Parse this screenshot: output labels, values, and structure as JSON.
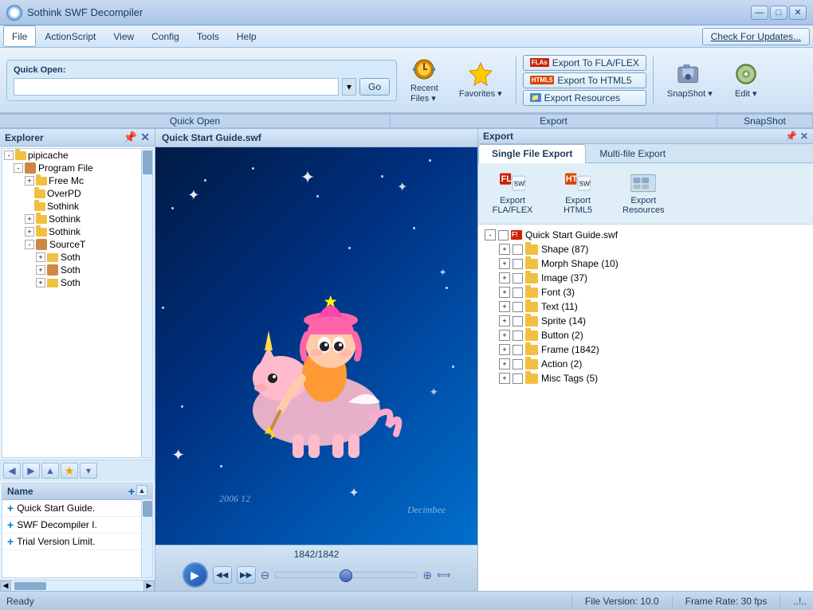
{
  "app": {
    "title": "Sothink SWF Decompiler",
    "check_updates": "Check For Updates..."
  },
  "titlebar": {
    "minimize": "—",
    "maximize": "□",
    "close": "✕"
  },
  "menu": {
    "items": [
      "File",
      "ActionScript",
      "View",
      "Config",
      "Tools",
      "Help"
    ]
  },
  "toolbar": {
    "quick_open_label": "Quick Open:",
    "go_btn": "Go",
    "recent_label": "Recent\nFiles ▾",
    "favorites_label": "Favorites\n▾",
    "export_fla": "Export To FLA/FLEX",
    "export_html5": "Export To HTML5",
    "export_res": "Export Resources",
    "export_group": "Export",
    "snapshot_label": "SnapShot\n▾",
    "edit_label": "Edit\n▾",
    "snapshot_group": "SnapShot",
    "quick_open_section": "Quick Open"
  },
  "explorer": {
    "title": "Explorer",
    "tree_items": [
      {
        "label": "pipicache",
        "level": 0,
        "type": "folder",
        "expanded": true,
        "has_children": true
      },
      {
        "label": "Program File",
        "level": 1,
        "type": "folder",
        "expanded": true,
        "has_children": true
      },
      {
        "label": "Free Mc",
        "level": 2,
        "type": "folder",
        "expanded": false,
        "has_children": true
      },
      {
        "label": "OverPD",
        "level": 2,
        "type": "folder",
        "expanded": false,
        "has_children": false
      },
      {
        "label": "Sothink",
        "level": 2,
        "type": "folder",
        "expanded": false,
        "has_children": false
      },
      {
        "label": "Sothink",
        "level": 2,
        "type": "folder",
        "expanded": false,
        "has_children": true
      },
      {
        "label": "Sothink",
        "level": 2,
        "type": "folder",
        "expanded": false,
        "has_children": true
      },
      {
        "label": "SourceT",
        "level": 2,
        "type": "folder",
        "expanded": true,
        "has_children": true
      },
      {
        "label": "Soth",
        "level": 3,
        "type": "file",
        "has_children": false
      },
      {
        "label": "Soth",
        "level": 3,
        "type": "file",
        "has_children": false
      },
      {
        "label": "Soth",
        "level": 3,
        "type": "file",
        "has_children": false
      }
    ]
  },
  "bottom_list": {
    "header": "Name",
    "items": [
      "Quick Start Guide.",
      "SWF Decompiler I.",
      "Trial Version Limit."
    ]
  },
  "swf_panel": {
    "title": "Quick Start Guide.swf",
    "frame_counter": "1842/1842",
    "watermark": "Decimbee",
    "date": "2006  12"
  },
  "export_panel": {
    "title": "Export",
    "tabs": [
      "Single File Export",
      "Multi-file Export"
    ],
    "active_tab": 0,
    "export_btns": [
      {
        "label": "Export\nFLA/FLEX",
        "type": "fla"
      },
      {
        "label": "Export\nHTML5",
        "type": "html5"
      },
      {
        "label": "Export\nResources",
        "type": "res"
      }
    ],
    "tree": {
      "root": "Quick Start Guide.swf",
      "items": [
        {
          "label": "Shape (87)",
          "count": 87
        },
        {
          "label": "Morph Shape (10)",
          "count": 10
        },
        {
          "label": "Image (37)",
          "count": 37
        },
        {
          "label": "Font (3)",
          "count": 3
        },
        {
          "label": "Text (11)",
          "count": 11
        },
        {
          "label": "Sprite (14)",
          "count": 14
        },
        {
          "label": "Button (2)",
          "count": 2
        },
        {
          "label": "Frame (1842)",
          "count": 1842
        },
        {
          "label": "Action (2)",
          "count": 2
        },
        {
          "label": "Misc Tags (5)",
          "count": 5
        }
      ]
    }
  },
  "status_bar": {
    "status": "Ready",
    "file_version": "File Version: 10.0",
    "frame_rate": "Frame Rate: 30 fps"
  }
}
